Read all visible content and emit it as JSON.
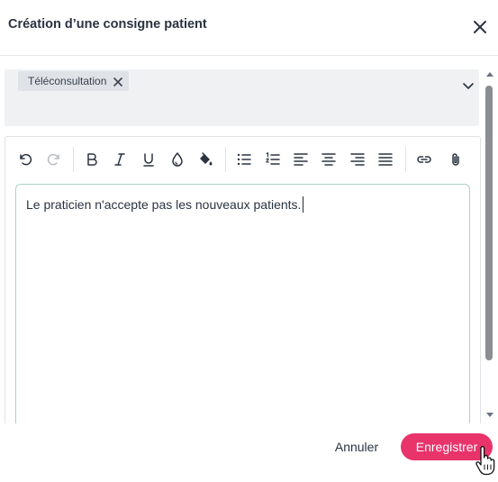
{
  "dialog": {
    "title": "Création d’une consigne patient",
    "close_icon": "close-icon"
  },
  "tags": {
    "selected": [
      {
        "label": "Téléconsultation",
        "remove_icon": "close-icon"
      }
    ],
    "dropdown_icon": "chevron-down-icon"
  },
  "editor": {
    "toolbar": [
      {
        "name": "undo",
        "icon": "undo-icon"
      },
      {
        "name": "redo",
        "icon": "redo-icon"
      },
      {
        "name": "bold",
        "icon": "bold-icon"
      },
      {
        "name": "italic",
        "icon": "italic-icon"
      },
      {
        "name": "underline",
        "icon": "underline-icon"
      },
      {
        "name": "text-color",
        "icon": "droplet-icon"
      },
      {
        "name": "highlight",
        "icon": "paint-bucket-icon"
      },
      {
        "name": "bullet-list",
        "icon": "bullet-list-icon"
      },
      {
        "name": "numbered-list",
        "icon": "numbered-list-icon"
      },
      {
        "name": "align-left",
        "icon": "align-left-icon"
      },
      {
        "name": "align-center",
        "icon": "align-center-icon"
      },
      {
        "name": "align-right",
        "icon": "align-right-icon"
      },
      {
        "name": "align-justify",
        "icon": "align-justify-icon"
      },
      {
        "name": "link",
        "icon": "link-icon"
      },
      {
        "name": "attachment",
        "icon": "paperclip-icon"
      }
    ],
    "content": "Le praticien n'accepte pas les nouveaux patients."
  },
  "footer": {
    "cancel_label": "Annuler",
    "save_label": "Enregistrer"
  },
  "colors": {
    "primary": "#e8346b",
    "editor_border": "#a9d3c9",
    "tag_box_bg": "#eff1f3",
    "chip_bg": "#dfe2e6"
  }
}
